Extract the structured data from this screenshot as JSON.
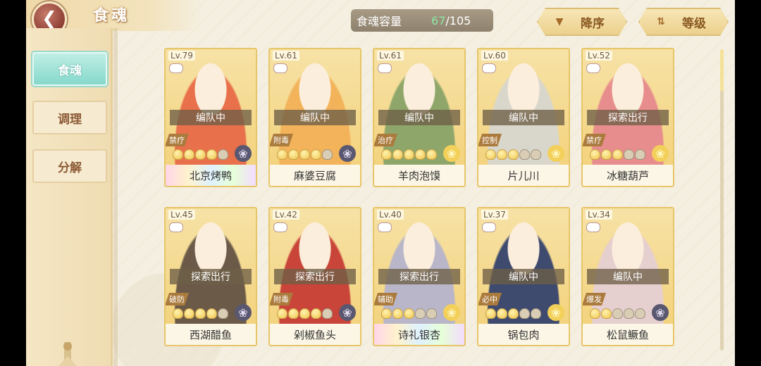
{
  "header": {
    "title": "食魂"
  },
  "sidebar": {
    "items": [
      {
        "label": "食魂",
        "active": true
      },
      {
        "label": "调理",
        "active": false
      },
      {
        "label": "分解",
        "active": false
      }
    ]
  },
  "capacity": {
    "label": "食魂容量",
    "current": "67",
    "total": "/105"
  },
  "sort": {
    "order_label": "降序",
    "by_label": "等级"
  },
  "colors": {
    "accent_teal": "#86d8cb",
    "card_gold": "#e7c568",
    "capacity_green": "#8ce8a8"
  },
  "cards": [
    {
      "level": "Lv.79",
      "status": "编队中",
      "role": "禁疗",
      "stars_on": 4,
      "stars_off": 1,
      "flower": "dark",
      "name": "北京烤鸭",
      "rainbow": true,
      "hue": "#e8704a"
    },
    {
      "level": "Lv.61",
      "status": "编队中",
      "role": "附毒",
      "stars_on": 4,
      "stars_off": 1,
      "flower": "dark",
      "name": "麻婆豆腐",
      "rainbow": false,
      "hue": "#f2b35a"
    },
    {
      "level": "Lv.61",
      "status": "编队中",
      "role": "治疗",
      "stars_on": 5,
      "stars_off": 0,
      "flower": "gold",
      "name": "羊肉泡馍",
      "rainbow": false,
      "hue": "#8fa66a"
    },
    {
      "level": "Lv.60",
      "status": "编队中",
      "role": "控制",
      "stars_on": 3,
      "stars_off": 2,
      "flower": "gold",
      "name": "片儿川",
      "rainbow": false,
      "hue": "#d9d6cc"
    },
    {
      "level": "Lv.52",
      "status": "探索出行",
      "role": "禁疗",
      "stars_on": 3,
      "stars_off": 2,
      "flower": "gold",
      "name": "冰糖葫芦",
      "rainbow": false,
      "hue": "#e78d8d"
    },
    {
      "level": "Lv.45",
      "status": "探索出行",
      "role": "破防",
      "stars_on": 4,
      "stars_off": 1,
      "flower": "dark",
      "name": "西湖醋鱼",
      "rainbow": false,
      "hue": "#6b5a48"
    },
    {
      "level": "Lv.42",
      "status": "探索出行",
      "role": "附毒",
      "stars_on": 4,
      "stars_off": 1,
      "flower": "dark",
      "name": "剁椒鱼头",
      "rainbow": false,
      "hue": "#c9453a"
    },
    {
      "level": "Lv.40",
      "status": "探索出行",
      "role": "辅助",
      "stars_on": 3,
      "stars_off": 2,
      "flower": "gold",
      "name": "诗礼银杏",
      "rainbow": true,
      "hue": "#b8b6c8"
    },
    {
      "level": "Lv.37",
      "status": "编队中",
      "role": "必中",
      "stars_on": 3,
      "stars_off": 2,
      "flower": "gold",
      "name": "锅包肉",
      "rainbow": false,
      "hue": "#3e4a6e"
    },
    {
      "level": "Lv.34",
      "status": "编队中",
      "role": "爆发",
      "stars_on": 2,
      "stars_off": 3,
      "flower": "dark",
      "name": "松鼠鳜鱼",
      "rainbow": false,
      "hue": "#e6cfcf"
    }
  ]
}
